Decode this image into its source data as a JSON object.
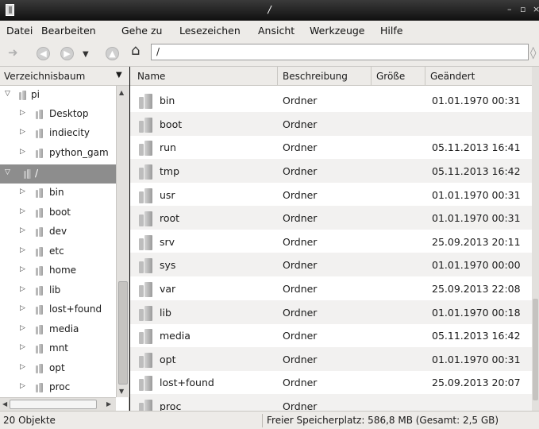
{
  "window": {
    "title": "/"
  },
  "menu": [
    {
      "label": "Datei"
    },
    {
      "label": "Bearbeiten"
    },
    {
      "label": "Gehe zu"
    },
    {
      "label": "Lesezeichen"
    },
    {
      "label": "Ansicht"
    },
    {
      "label": "Werkzeuge"
    },
    {
      "label": "Hilfe"
    }
  ],
  "toolbar": {
    "path": "/"
  },
  "tree": {
    "header": "Verzeichnisbaum",
    "nodes": [
      {
        "label": "pi"
      },
      {
        "label": "Desktop"
      },
      {
        "label": "indiecity"
      },
      {
        "label": "python_gam"
      },
      {
        "label": "/"
      },
      {
        "label": "bin"
      },
      {
        "label": "boot"
      },
      {
        "label": "dev"
      },
      {
        "label": "etc"
      },
      {
        "label": "home"
      },
      {
        "label": "lib"
      },
      {
        "label": "lost+found"
      },
      {
        "label": "media"
      },
      {
        "label": "mnt"
      },
      {
        "label": "opt"
      },
      {
        "label": "proc"
      }
    ]
  },
  "list": {
    "columns": [
      "Name",
      "Beschreibung",
      "Größe",
      "Geändert"
    ],
    "rows": [
      {
        "name": "bin",
        "desc": "Ordner",
        "size": "",
        "modified": "01.01.1970 00:31"
      },
      {
        "name": "boot",
        "desc": "Ordner",
        "size": "",
        "modified": ""
      },
      {
        "name": "run",
        "desc": "Ordner",
        "size": "",
        "modified": "05.11.2013 16:41"
      },
      {
        "name": "tmp",
        "desc": "Ordner",
        "size": "",
        "modified": "05.11.2013 16:42"
      },
      {
        "name": "usr",
        "desc": "Ordner",
        "size": "",
        "modified": "01.01.1970 00:31"
      },
      {
        "name": "root",
        "desc": "Ordner",
        "size": "",
        "modified": "01.01.1970 00:31"
      },
      {
        "name": "srv",
        "desc": "Ordner",
        "size": "",
        "modified": "25.09.2013 20:11"
      },
      {
        "name": "sys",
        "desc": "Ordner",
        "size": "",
        "modified": "01.01.1970 00:00"
      },
      {
        "name": "var",
        "desc": "Ordner",
        "size": "",
        "modified": "25.09.2013 22:08"
      },
      {
        "name": "lib",
        "desc": "Ordner",
        "size": "",
        "modified": "01.01.1970 00:18"
      },
      {
        "name": "media",
        "desc": "Ordner",
        "size": "",
        "modified": "05.11.2013 16:42"
      },
      {
        "name": "opt",
        "desc": "Ordner",
        "size": "",
        "modified": "01.01.1970 00:31"
      },
      {
        "name": "lost+found",
        "desc": "Ordner",
        "size": "",
        "modified": "25.09.2013 20:07"
      },
      {
        "name": "proc",
        "desc": "Ordner",
        "size": "",
        "modified": ""
      }
    ]
  },
  "status": {
    "count": "20 Objekte",
    "space": "Freier Speicherplatz: 586,8 MB (Gesamt: 2,5 GB)"
  }
}
